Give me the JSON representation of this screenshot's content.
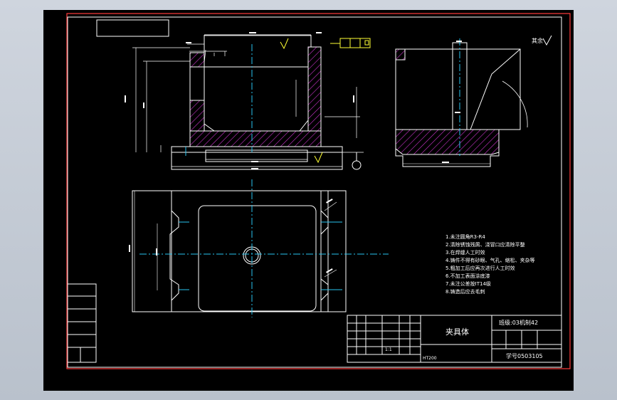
{
  "drawing": {
    "roughness_symbol": "其余",
    "notes": [
      "1.未注圆角R3-R4",
      "2.清除锈蚀残屑、浇冒口应清除平整",
      "3.在焊缝人工时效",
      "4.铸件不得有砂眼、气孔、缩松、夹杂等",
      "5.粗加工后应再次进行人工时效",
      "6.不加工表面涂底漆",
      "7.未注公差按IT14级",
      "8.铸造后应去毛刺"
    ],
    "title_block": {
      "part_name": "夹具体",
      "class_name": "班级:03机制42",
      "student_no": "学号0503105",
      "material": "HT200",
      "scale": "1:1"
    }
  },
  "colors": {
    "background": "#000000",
    "frame": "#ff3b3b",
    "lines": "#ffffff",
    "hatch": "#cc33cc",
    "center": "#27c4f0",
    "dims": "#ffffff",
    "accent": "#ffff33"
  }
}
